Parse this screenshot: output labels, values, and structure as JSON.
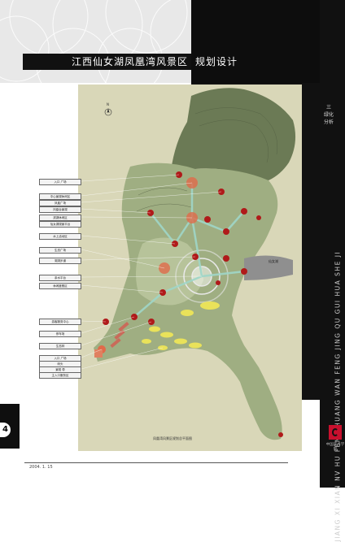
{
  "page": {
    "title": "江西仙女湖凤凰湾风景区",
    "subtitle": "规划设计",
    "page_number": "4",
    "date": "2004. 1. 15"
  },
  "sidebar": {
    "category": "三 绿化分析",
    "vertical_text": "JIANG XI XIAN NV HU FENG HUANG WAN FENG JING QU GUI HUA SHE JI",
    "logo_caption": "中国美术学院"
  },
  "map": {
    "caption": "凤凰湾风景区规划总平面图",
    "north_label": "N",
    "water_label": "仙女湖",
    "colors": {
      "hill": "#6b7a55",
      "land": "#a9b78c",
      "water": "#8f8f8f",
      "node": "#b01a1a",
      "lawn": "#e9e25a",
      "path": "#9fd6c8"
    }
  },
  "legend": [
    "入口 广场",
    "中心景观休闲区",
    "凤凰广场",
    "凤凰台景观",
    "滨湖休闲区",
    "仙女湖观景平台",
    "水上活动区",
    "生态广场",
    "湖滨步道",
    "亲水平台",
    "休闲度假区",
    "游客服务中心",
    "停车场",
    "生态林",
    "入口 广场",
    "码头",
    "景观 带",
    "主入口服务区"
  ]
}
